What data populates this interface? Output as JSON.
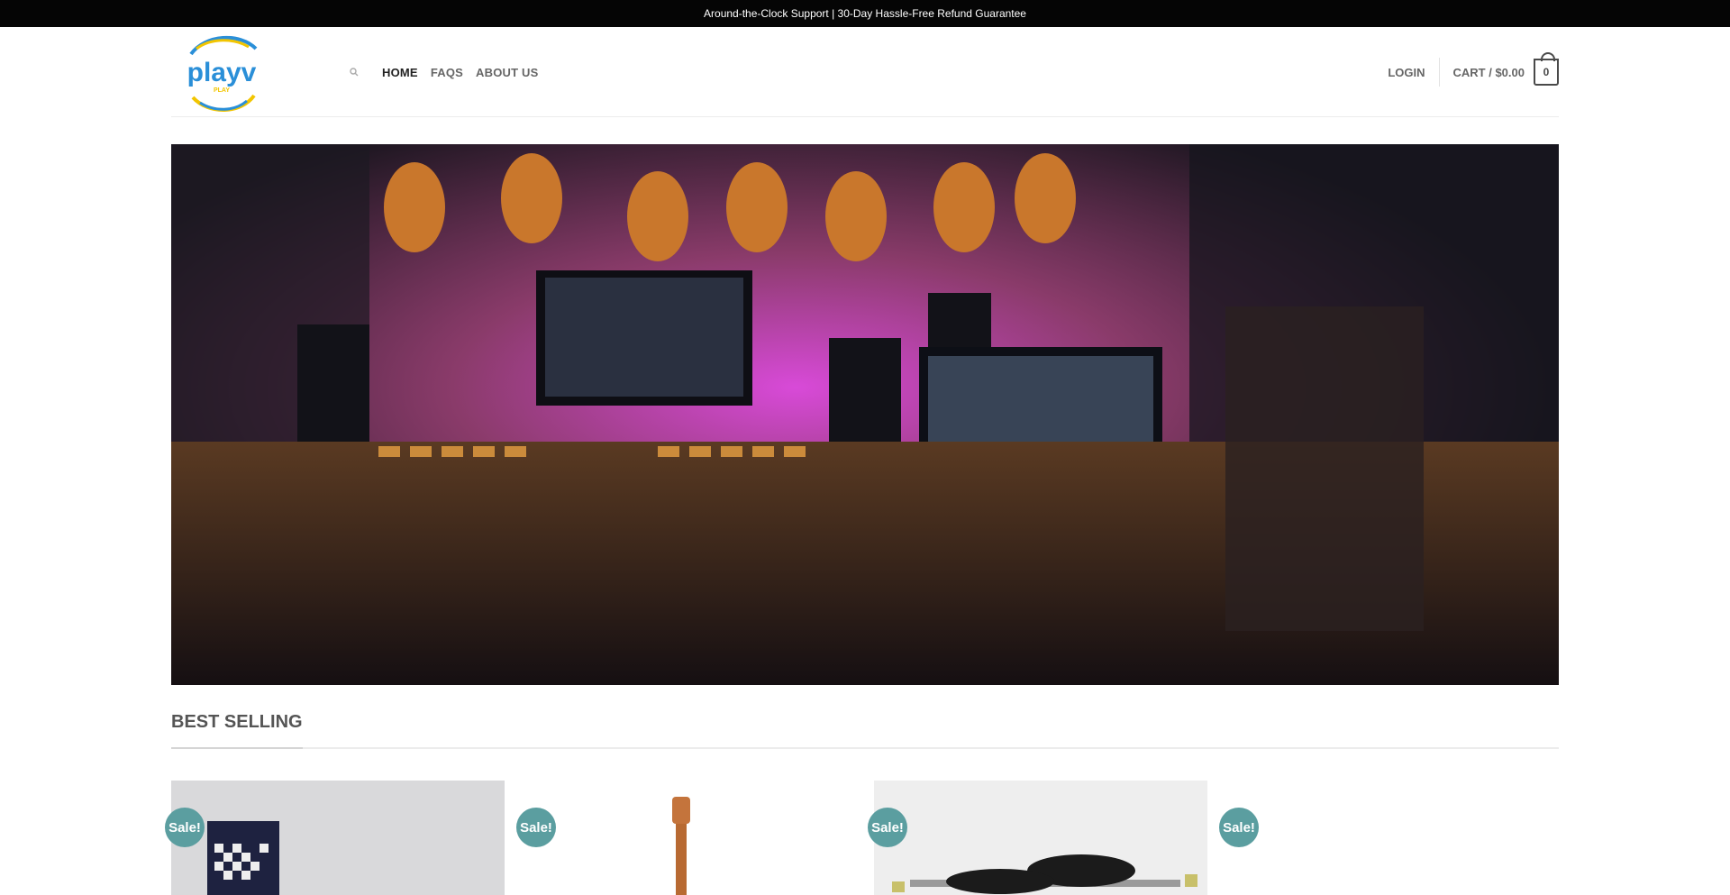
{
  "topbar": {
    "text": "Around-the-Clock Support | 30-Day Hassle-Free Refund Guarantee"
  },
  "brand": {
    "logo_text": "playv",
    "logo_subtext": "PLAY",
    "primary_color": "#2a8fd8",
    "accent_color": "#f2c500"
  },
  "nav": {
    "search_icon": "search-icon",
    "items": [
      {
        "label": "HOME",
        "active": true
      },
      {
        "label": "FAQS",
        "active": false
      },
      {
        "label": "ABOUT US",
        "active": false
      }
    ]
  },
  "account": {
    "login_label": "LOGIN",
    "cart_label": "CART / $0.00",
    "cart_count": "0"
  },
  "section": {
    "title": "BEST SELLING"
  },
  "products": [
    {
      "badge": "Sale!"
    },
    {
      "badge": "Sale!"
    },
    {
      "badge": "Sale!"
    },
    {
      "badge": "Sale!"
    }
  ],
  "colors": {
    "sale_badge": "#5b9ea0",
    "topbar_bg": "#050505"
  }
}
